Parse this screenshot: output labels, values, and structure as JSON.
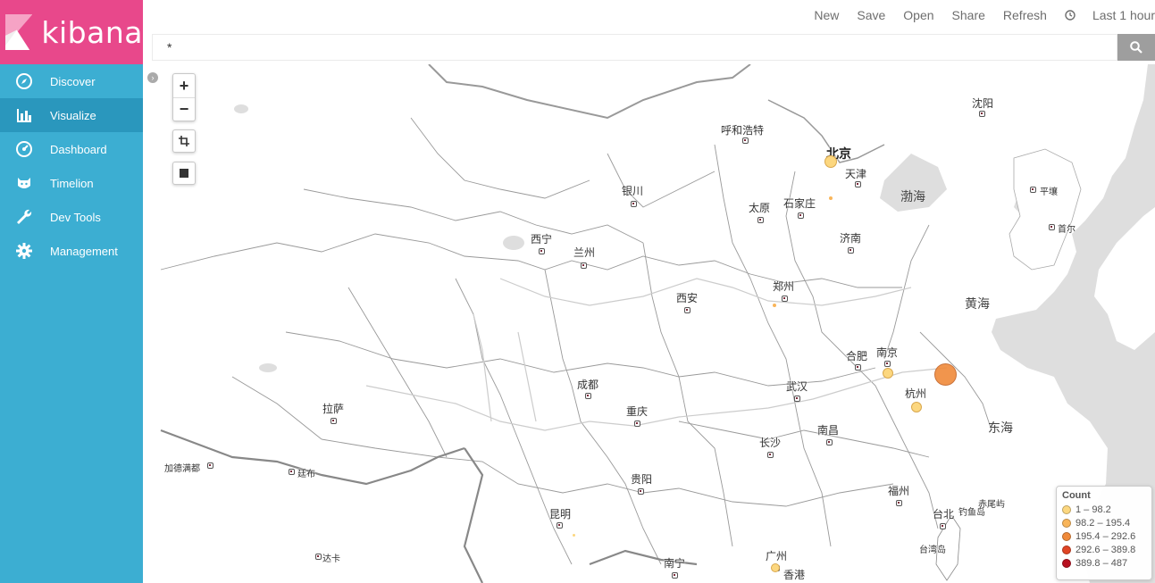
{
  "app": {
    "logo_text": "kibana"
  },
  "sidebar": {
    "items": [
      {
        "label": "Discover",
        "icon": "compass-icon",
        "active": false
      },
      {
        "label": "Visualize",
        "icon": "bar-chart-icon",
        "active": true
      },
      {
        "label": "Dashboard",
        "icon": "dashboard-gauge-icon",
        "active": false
      },
      {
        "label": "Timelion",
        "icon": "timelion-cat-icon",
        "active": false
      },
      {
        "label": "Dev Tools",
        "icon": "wrench-icon",
        "active": false
      },
      {
        "label": "Management",
        "icon": "gear-icon",
        "active": false
      }
    ]
  },
  "topbar": {
    "new_label": "New",
    "save_label": "Save",
    "open_label": "Open",
    "share_label": "Share",
    "refresh_label": "Refresh",
    "time_label": "Last 1 hour"
  },
  "search": {
    "value": "*"
  },
  "map": {
    "cities": [
      {
        "name": "沈阳"
      },
      {
        "name": "呼和浩特"
      },
      {
        "name": "北京"
      },
      {
        "name": "天津"
      },
      {
        "name": "平壤"
      },
      {
        "name": "首尔"
      },
      {
        "name": "银川"
      },
      {
        "name": "太原"
      },
      {
        "name": "石家庄"
      },
      {
        "name": "西宁"
      },
      {
        "name": "兰州"
      },
      {
        "name": "济南"
      },
      {
        "name": "郑州"
      },
      {
        "name": "西安"
      },
      {
        "name": "合肥"
      },
      {
        "name": "南京"
      },
      {
        "name": "杭州"
      },
      {
        "name": "成都"
      },
      {
        "name": "武汉"
      },
      {
        "name": "重庆"
      },
      {
        "name": "拉萨"
      },
      {
        "name": "长沙"
      },
      {
        "name": "南昌"
      },
      {
        "name": "加德满都"
      },
      {
        "name": "廷布"
      },
      {
        "name": "贵阳"
      },
      {
        "name": "福州"
      },
      {
        "name": "台北"
      },
      {
        "name": "昆明"
      },
      {
        "name": "钓鱼岛"
      },
      {
        "name": "赤尾屿"
      },
      {
        "name": "达卡"
      },
      {
        "name": "广州"
      },
      {
        "name": "南宁"
      },
      {
        "name": "香港"
      },
      {
        "name": "台湾岛"
      }
    ],
    "seas": [
      {
        "name": "渤海"
      },
      {
        "name": "黄海"
      },
      {
        "name": "东海"
      }
    ]
  },
  "legend": {
    "title": "Count",
    "ranges": [
      {
        "label": "1 – 98.2",
        "color": "#fcd77f"
      },
      {
        "label": "98.2 – 195.4",
        "color": "#f9b55a"
      },
      {
        "label": "195.4 – 292.6",
        "color": "#f08a3a"
      },
      {
        "label": "292.6 – 389.8",
        "color": "#e04524"
      },
      {
        "label": "389.8 – 487",
        "color": "#b8101f"
      }
    ]
  }
}
